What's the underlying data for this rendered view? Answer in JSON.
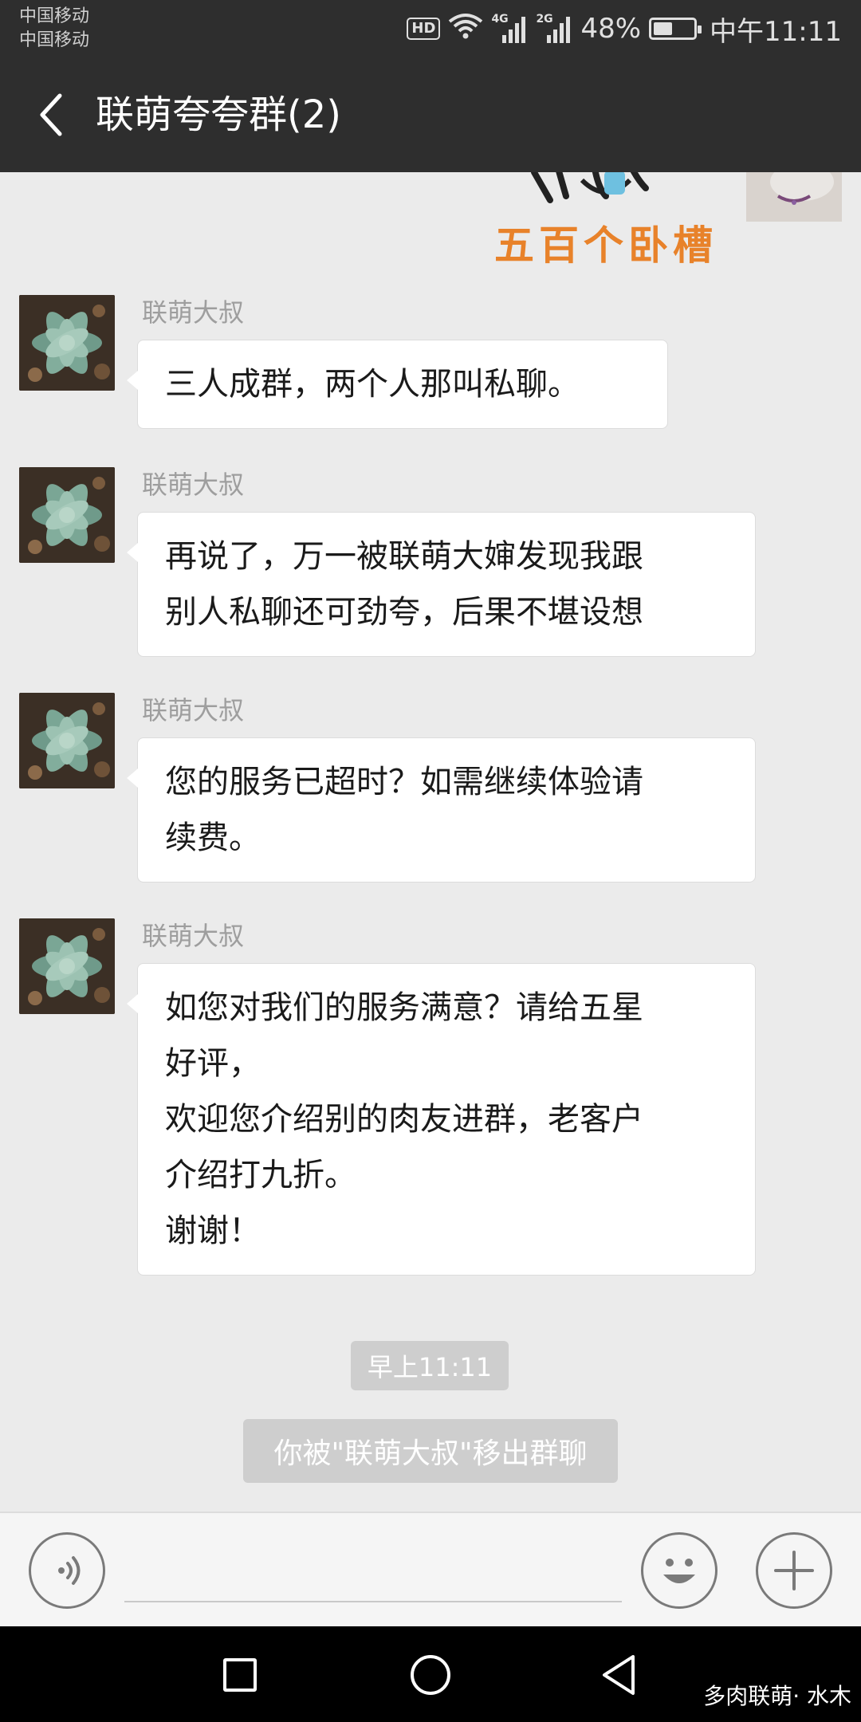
{
  "status_bar": {
    "carrier_1": "中国移动",
    "carrier_2": "中国移动",
    "hd": "HD",
    "net_1": "4G",
    "net_2": "2G",
    "battery": "48%",
    "battery_level": 0.48,
    "time": "中午11:11"
  },
  "header": {
    "title": "联萌夸夸群(2)"
  },
  "sticker": {
    "caption": "五百个卧槽"
  },
  "messages": [
    {
      "sender": "联萌大叔",
      "lines": [
        "三人成群，两个人那叫私聊。"
      ]
    },
    {
      "sender": "联萌大叔",
      "lines": [
        "再说了，万一被联萌大婶发现我跟",
        "别人私聊还可劲夸，后果不堪设想"
      ]
    },
    {
      "sender": "联萌大叔",
      "lines": [
        "您的服务已超时？如需继续体验请",
        "续费。"
      ]
    },
    {
      "sender": "联萌大叔",
      "lines": [
        "如您对我们的服务满意？请给五星",
        "好评，",
        "欢迎您介绍别的肉友进群，老客户",
        "介绍打九折。",
        "谢谢！"
      ]
    }
  ],
  "timestamp": "早上11:11",
  "system_notice": "你被\"联萌大叔\"移出群聊",
  "input": {
    "value": "",
    "placeholder": ""
  },
  "watermark": "多肉联萌· 水木",
  "colors": {
    "header_bg": "#2e2e2e",
    "chat_bg": "#ebebeb",
    "bubble_bg": "#ffffff",
    "chip_bg": "#cecece",
    "sticker_text": "#e8822a"
  }
}
